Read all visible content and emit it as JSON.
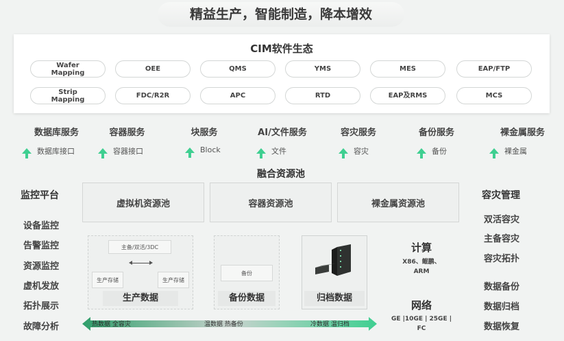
{
  "headline": "精益生产，智能制造，降本增效",
  "cim": {
    "title": "CIM软件生态",
    "row1": [
      "Wafer Mapping",
      "OEE",
      "QMS",
      "YMS",
      "MES",
      "EAP/FTP"
    ],
    "row2": [
      "Strip Mapping",
      "FDC/R2R",
      "APC",
      "RTD",
      "EAP及RMS",
      "MCS"
    ]
  },
  "services": [
    {
      "head": "数据库服务",
      "sub": "数据库接口"
    },
    {
      "head": "容器服务",
      "sub": "容器接口"
    },
    {
      "head": "块服务",
      "sub": "Block"
    },
    {
      "head": "AI/文件服务",
      "sub": "文件"
    },
    {
      "head": "容灾服务",
      "sub": "容灾"
    },
    {
      "head": "备份服务",
      "sub": "备份"
    },
    {
      "head": "裸金属服务",
      "sub": "裸金属"
    }
  ],
  "fusion": {
    "title": "融合资源池",
    "pools": [
      "虚拟机资源池",
      "容器资源池",
      "裸金属资源池"
    ]
  },
  "left_panel": {
    "title": "监控平台",
    "items": [
      "设备监控",
      "告警监控",
      "资源监控",
      "虚机发放",
      "拓扑展示",
      "故障分析"
    ]
  },
  "right_panel": {
    "title": "容灾管理",
    "group1": [
      "双活容灾",
      "主备容灾",
      "容灾拓扑"
    ],
    "group2": [
      "数据备份",
      "数据归档",
      "数据恢复"
    ]
  },
  "production": {
    "top": "主备/双活/3DC",
    "left": "生产存储",
    "right": "生产存储",
    "label": "生产数据"
  },
  "backup": {
    "inner": "备份",
    "label": "备份数据"
  },
  "archive": {
    "label": "归档数据"
  },
  "compute": {
    "title": "计算",
    "desc1": "X86、鲲鹏、",
    "desc2": "ARM"
  },
  "network": {
    "title": "网络",
    "desc1": "GE |10GE | 25GE |",
    "desc2": "FC"
  },
  "bar": {
    "left": "热数据 全容灾",
    "mid": "温数据 热备份",
    "right": "冷数据 温归档"
  },
  "colors": {
    "accent": "#3fcf91"
  }
}
